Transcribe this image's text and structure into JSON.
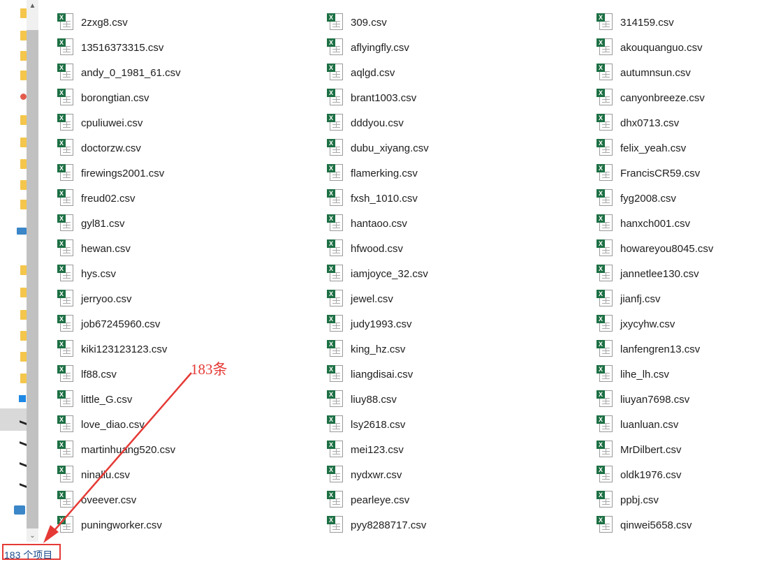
{
  "files": [
    "2zxg8.csv",
    "309.csv",
    "314159.csv",
    "13516373315.csv",
    "aflyingfly.csv",
    "akouquanguo.csv",
    "andy_0_1981_61.csv",
    "aqlgd.csv",
    "autumnsun.csv",
    "borongtian.csv",
    "brant1003.csv",
    "canyonbreeze.csv",
    "cpuliuwei.csv",
    "dddyou.csv",
    "dhx0713.csv",
    "doctorzw.csv",
    "dubu_xiyang.csv",
    "felix_yeah.csv",
    "firewings2001.csv",
    "flamerking.csv",
    "FrancisCR59.csv",
    "freud02.csv",
    "fxsh_1010.csv",
    "fyg2008.csv",
    "gyl81.csv",
    "hantaoo.csv",
    "hanxch001.csv",
    "hewan.csv",
    "hfwood.csv",
    "howareyou8045.csv",
    "hys.csv",
    "iamjoyce_32.csv",
    "jannetlee130.csv",
    "jerryoo.csv",
    "jewel.csv",
    "jianfj.csv",
    "job67245960.csv",
    "judy1993.csv",
    "jxycyhw.csv",
    "kiki123123123.csv",
    "king_hz.csv",
    "lanfengren13.csv",
    "lf88.csv",
    "liangdisai.csv",
    "lihe_lh.csv",
    "little_G.csv",
    "liuy88.csv",
    "liuyan7698.csv",
    "love_diao.csv",
    "lsy2618.csv",
    "luanluan.csv",
    "martinhuang520.csv",
    "mei123.csv",
    "MrDilbert.csv",
    "ninaliu.csv",
    "nydxwr.csv",
    "oldk1976.csv",
    "oveever.csv",
    "pearleye.csv",
    "ppbj.csv",
    "puningworker.csv",
    "pyy8288717.csv",
    "qinwei5658.csv"
  ],
  "file_icon": "excel-csv-icon",
  "status_bar": {
    "item_count": "183 个项目"
  },
  "annotation": {
    "label": "183条",
    "color": "#e53935"
  },
  "scrollbar": {
    "up_arrow": "▲",
    "down_arrow": "⌄"
  }
}
